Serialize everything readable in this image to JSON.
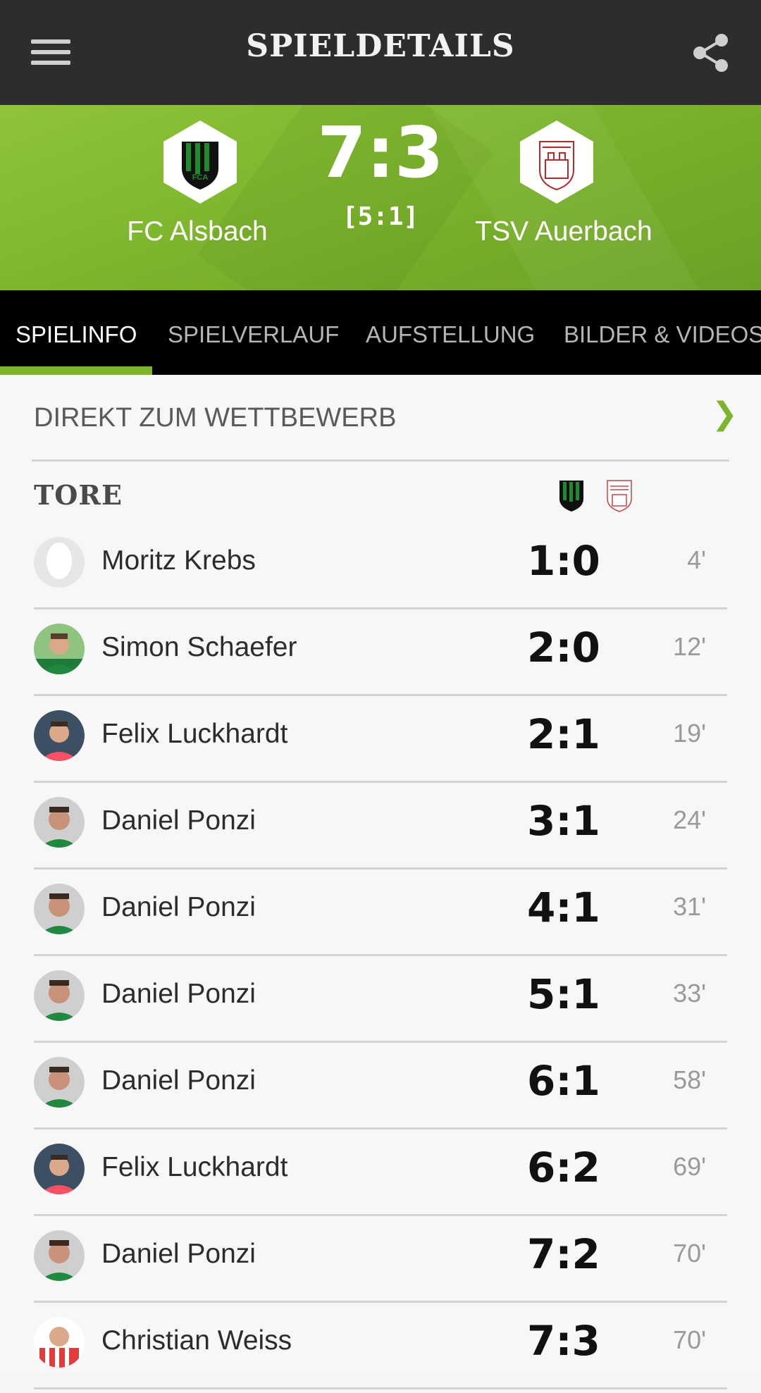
{
  "header": {
    "title": "SPIELDETAILS"
  },
  "match": {
    "home_team": "FC Alsbach",
    "away_team": "TSV Auerbach",
    "score": "7:3",
    "halftime": "[5:1]",
    "home_crest_text": "FCA"
  },
  "tabs": [
    {
      "label": "SPIELINFO",
      "active": true
    },
    {
      "label": "SPIELVERLAUF",
      "active": false
    },
    {
      "label": "AUFSTELLUNG",
      "active": false
    },
    {
      "label": "BILDER & VIDEOS",
      "active": false
    }
  ],
  "competition_link": {
    "label": "DIREKT ZUM WETTBEWERB",
    "chevron": "❯"
  },
  "goals_section": {
    "title": "TORE"
  },
  "goals": [
    {
      "player": "Moritz Krebs",
      "score": "1:0",
      "minute": "4'",
      "avatar": "placeholder"
    },
    {
      "player": "Simon Schaefer",
      "score": "2:0",
      "minute": "12'",
      "avatar": "green"
    },
    {
      "player": "Felix Luckhardt",
      "score": "2:1",
      "minute": "19'",
      "avatar": "red"
    },
    {
      "player": "Daniel Ponzi",
      "score": "3:1",
      "minute": "24'",
      "avatar": "grey"
    },
    {
      "player": "Daniel Ponzi",
      "score": "4:1",
      "minute": "31'",
      "avatar": "grey"
    },
    {
      "player": "Daniel Ponzi",
      "score": "5:1",
      "minute": "33'",
      "avatar": "grey"
    },
    {
      "player": "Daniel Ponzi",
      "score": "6:1",
      "minute": "58'",
      "avatar": "grey"
    },
    {
      "player": "Felix Luckhardt",
      "score": "6:2",
      "minute": "69'",
      "avatar": "red"
    },
    {
      "player": "Daniel Ponzi",
      "score": "7:2",
      "minute": "70'",
      "avatar": "grey"
    },
    {
      "player": "Christian Weiss",
      "score": "7:3",
      "minute": "70'",
      "avatar": "stripes"
    }
  ],
  "colors": {
    "topbar": "#2d2d2d",
    "accent_green": "#7cb52c",
    "tabs_bg": "#000000",
    "home_crest_green": "#1f8a2e",
    "away_crest_red": "#b52a2a"
  }
}
